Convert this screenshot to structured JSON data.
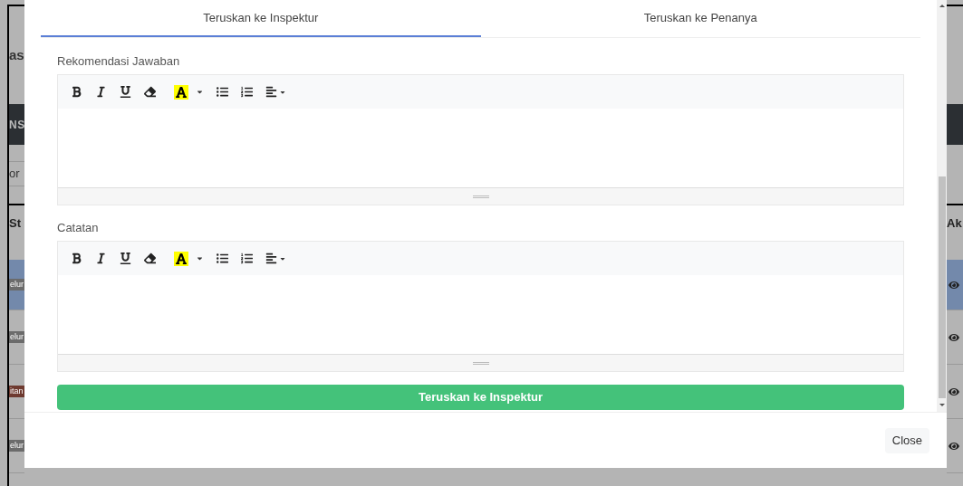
{
  "background_page": {
    "left": {
      "heading": "as",
      "dark_bar": "NS",
      "field": "or",
      "column": "St",
      "badges": [
        {
          "text": "elur",
          "color": "#6b6b6b",
          "highlighted": true
        },
        {
          "text": "elur",
          "color": "#6b6b6b",
          "highlighted": false
        },
        {
          "text": "itan",
          "color": "#6e3a30",
          "highlighted": false
        },
        {
          "text": "elur",
          "color": "#6b6b6b",
          "highlighted": false
        }
      ]
    },
    "right": {
      "column": "Ak"
    }
  },
  "modal": {
    "tabs": [
      {
        "label": "Teruskan ke Inspektur",
        "selected": true
      },
      {
        "label": "Teruskan ke Penanya",
        "selected": false
      }
    ],
    "editors": [
      {
        "label": "Rekomendasi Jawaban"
      },
      {
        "label": "Catatan"
      }
    ],
    "submit_button": "Teruskan ke Inspektur",
    "close_button": "Close"
  }
}
